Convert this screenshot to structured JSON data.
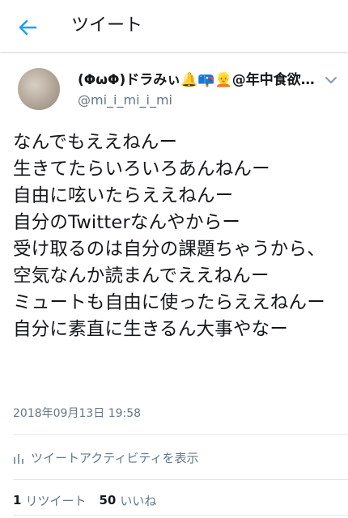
{
  "header": {
    "title": "ツイート"
  },
  "author": {
    "display_name_text": "(ΦωΦ)ドラみぃ",
    "display_name_emoji": "🔔📪👱",
    "display_name_suffix": "@年中食欲…",
    "handle": "@mi_i_mi_i_mi"
  },
  "tweet": {
    "text": "なんでもええねんー\n生きてたらいろいろあんねんー\n自由に呟いたらええねんー\n自分のTwitterなんやからー\n受け取るのは自分の課題ちゃうから、空気なんか読まんでええねんー\nミュートも自由に使ったらええねんー\n自分に素直に生きるん大事やなー",
    "timestamp": "2018年09月13日 19:58"
  },
  "activity": {
    "label": "ツイートアクティビティを表示"
  },
  "stats": {
    "retweets_count": "1",
    "retweets_label": "リツイート",
    "likes_count": "50",
    "likes_label": "いいね"
  },
  "colors": {
    "accent": "#1da1f2",
    "text": "#14171a",
    "secondary": "#657786",
    "divider": "#e1e8ed"
  }
}
